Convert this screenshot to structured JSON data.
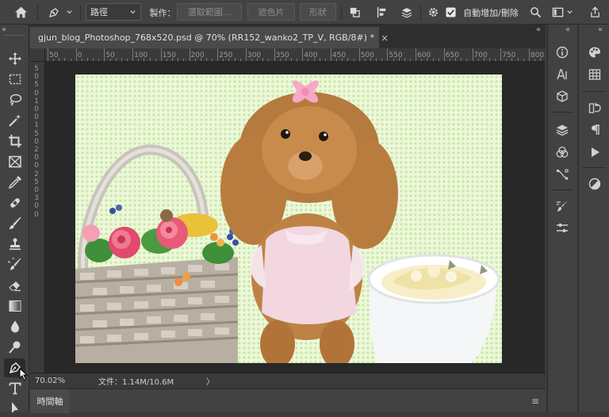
{
  "options_bar": {
    "mode_value": "路徑",
    "make_label": "製作：",
    "selection_button": "選取範圍...",
    "mask_button": "遮色片",
    "shape_button": "形狀",
    "auto_add_delete_label": "自動增加/刪除",
    "auto_add_delete_checked": true
  },
  "document": {
    "tab_title": "gjun_blog_Photoshop_768x520.psd @ 70% (RR152_wanko2_TP_V, RGB/8#) *",
    "close_glyph": "×"
  },
  "ruler": {
    "h_ticks": [
      "50",
      "0",
      "50",
      "100",
      "150",
      "200",
      "250",
      "300",
      "350",
      "400",
      "450",
      "500",
      "550",
      "600",
      "650",
      "700",
      "750",
      "800"
    ],
    "v_ticks": [
      "5",
      "0",
      "5",
      "0",
      "1",
      "0",
      "0",
      "1",
      "5",
      "0",
      "2",
      "0",
      "0",
      "2",
      "5",
      "0",
      "3",
      "0",
      "0"
    ]
  },
  "status_bar": {
    "zoom": "70.02%",
    "file_info": "文件：1.14M/10.6M",
    "arrow": "〉"
  },
  "timeline": {
    "label": "時間軸",
    "menu_glyph": "≡"
  },
  "collapse_glyph": "»",
  "expand_glyph": "«",
  "tools": [
    "move-tool",
    "marquee-tool",
    "lasso-tool",
    "magic-wand-tool",
    "crop-tool",
    "frame-tool",
    "eyedropper-tool",
    "healing-brush-tool",
    "brush-tool",
    "clone-stamp-tool",
    "history-brush-tool",
    "eraser-tool",
    "gradient-tool",
    "blur-tool",
    "dodge-tool",
    "pen-tool",
    "type-tool",
    "path-selection-tool"
  ],
  "colors": {
    "accent_bg": "#424242",
    "canvas_green": "#c5eaa0",
    "pasteboard": "#282828"
  }
}
